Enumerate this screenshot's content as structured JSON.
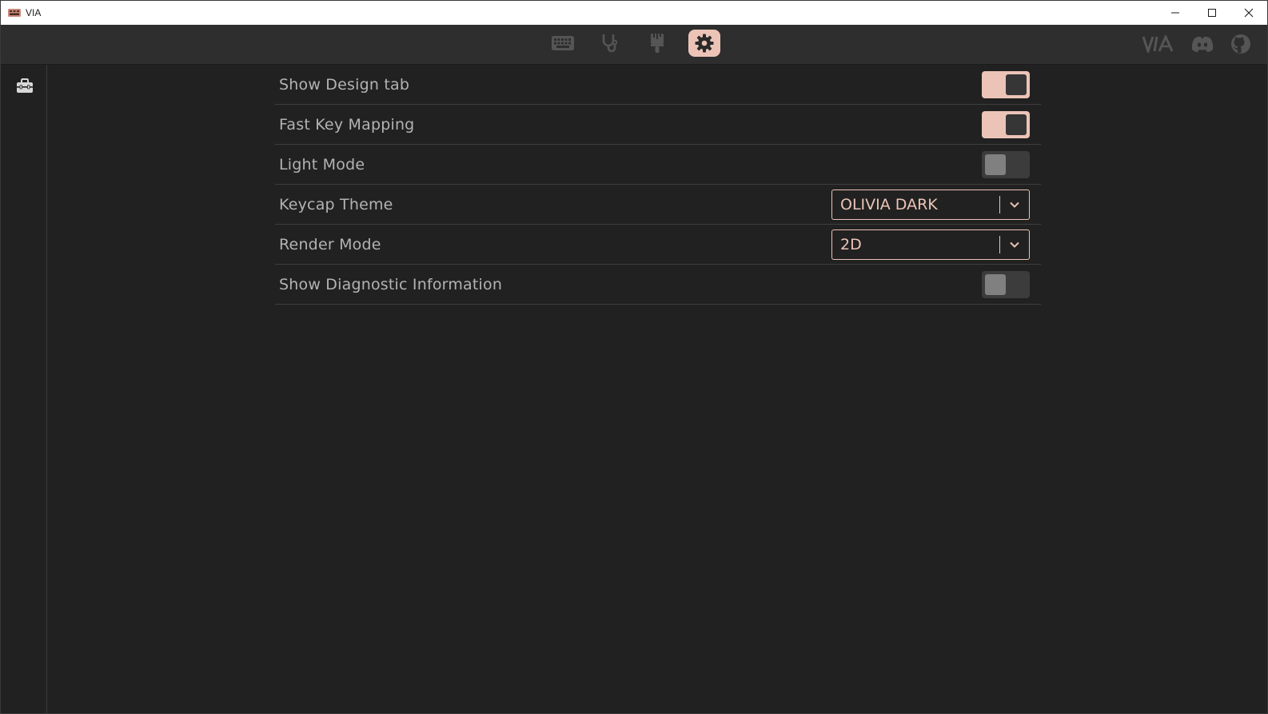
{
  "window": {
    "title": "VIA",
    "controls": [
      "minimize",
      "maximize",
      "close"
    ]
  },
  "nav": {
    "tabs": [
      {
        "name": "configure",
        "icon": "keyboard-icon",
        "active": false
      },
      {
        "name": "test",
        "icon": "stethoscope-icon",
        "active": false
      },
      {
        "name": "design",
        "icon": "paintbrush-icon",
        "active": false
      },
      {
        "name": "settings",
        "icon": "gear-icon",
        "active": true
      }
    ],
    "external_links": [
      {
        "name": "via",
        "icon": "via-logo-icon",
        "text": "VIA"
      },
      {
        "name": "discord",
        "icon": "discord-icon"
      },
      {
        "name": "github",
        "icon": "github-icon"
      }
    ]
  },
  "sidebar": {
    "items": [
      {
        "name": "general",
        "icon": "toolbox-icon"
      }
    ]
  },
  "settings": {
    "rows": [
      {
        "label": "Show Design tab",
        "control": "toggle",
        "value": true
      },
      {
        "label": "Fast Key Mapping",
        "control": "toggle",
        "value": true
      },
      {
        "label": "Light Mode",
        "control": "toggle",
        "value": false
      },
      {
        "label": "Keycap Theme",
        "control": "select",
        "value": "OLIVIA DARK"
      },
      {
        "label": "Render Mode",
        "control": "select",
        "value": "2D"
      },
      {
        "label": "Show Diagnostic Information",
        "control": "toggle",
        "value": false
      }
    ]
  },
  "colors": {
    "accent": "#ecc4b7",
    "background": "#212121",
    "menubar": "#2e2e2e",
    "label_text": "#b3b3b3",
    "icon_inactive": "#555555"
  }
}
